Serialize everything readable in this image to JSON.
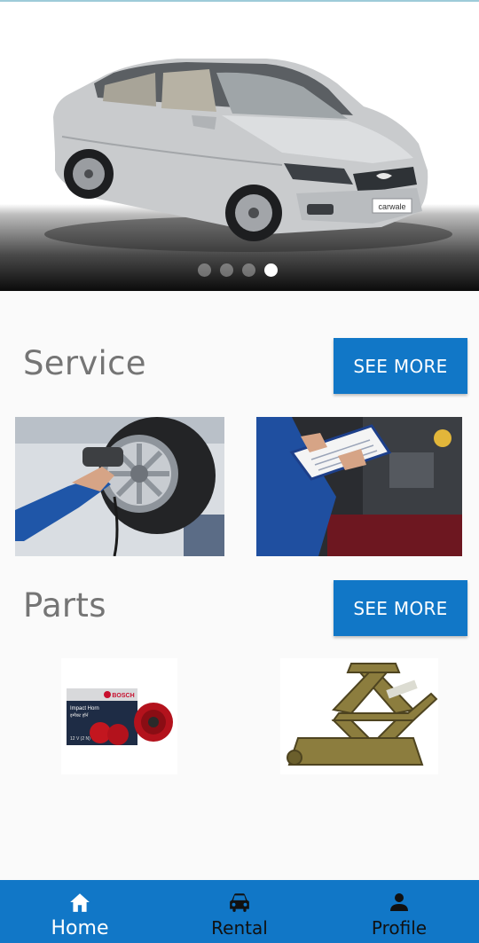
{
  "carousel": {
    "slides": 4,
    "active_index": 3,
    "slide_image": "silver-sedan-car",
    "watermark": "carwale"
  },
  "service": {
    "title": "Service",
    "see_more_label": "SEE MORE",
    "images": [
      "mechanic-tire-wrench",
      "mechanic-inspection-clipboard"
    ]
  },
  "parts": {
    "title": "Parts",
    "see_more_label": "SEE MORE",
    "images": [
      "bosch-impact-horn",
      "scissor-car-jack"
    ],
    "horn_box": {
      "brand": "BOSCH",
      "product": "Impact Horn",
      "subtitle": "इम्पैक्ट हॉर्न",
      "spec": "12 V  (2 N)"
    }
  },
  "bottom_nav": {
    "items": [
      {
        "label": "Home",
        "icon": "home-icon",
        "active": true
      },
      {
        "label": "Rental",
        "icon": "car-icon",
        "active": false
      },
      {
        "label": "Profile",
        "icon": "person-icon",
        "active": false
      }
    ]
  },
  "colors": {
    "primary": "#1177c7",
    "title_gray": "#757575",
    "background": "#fafafa"
  }
}
